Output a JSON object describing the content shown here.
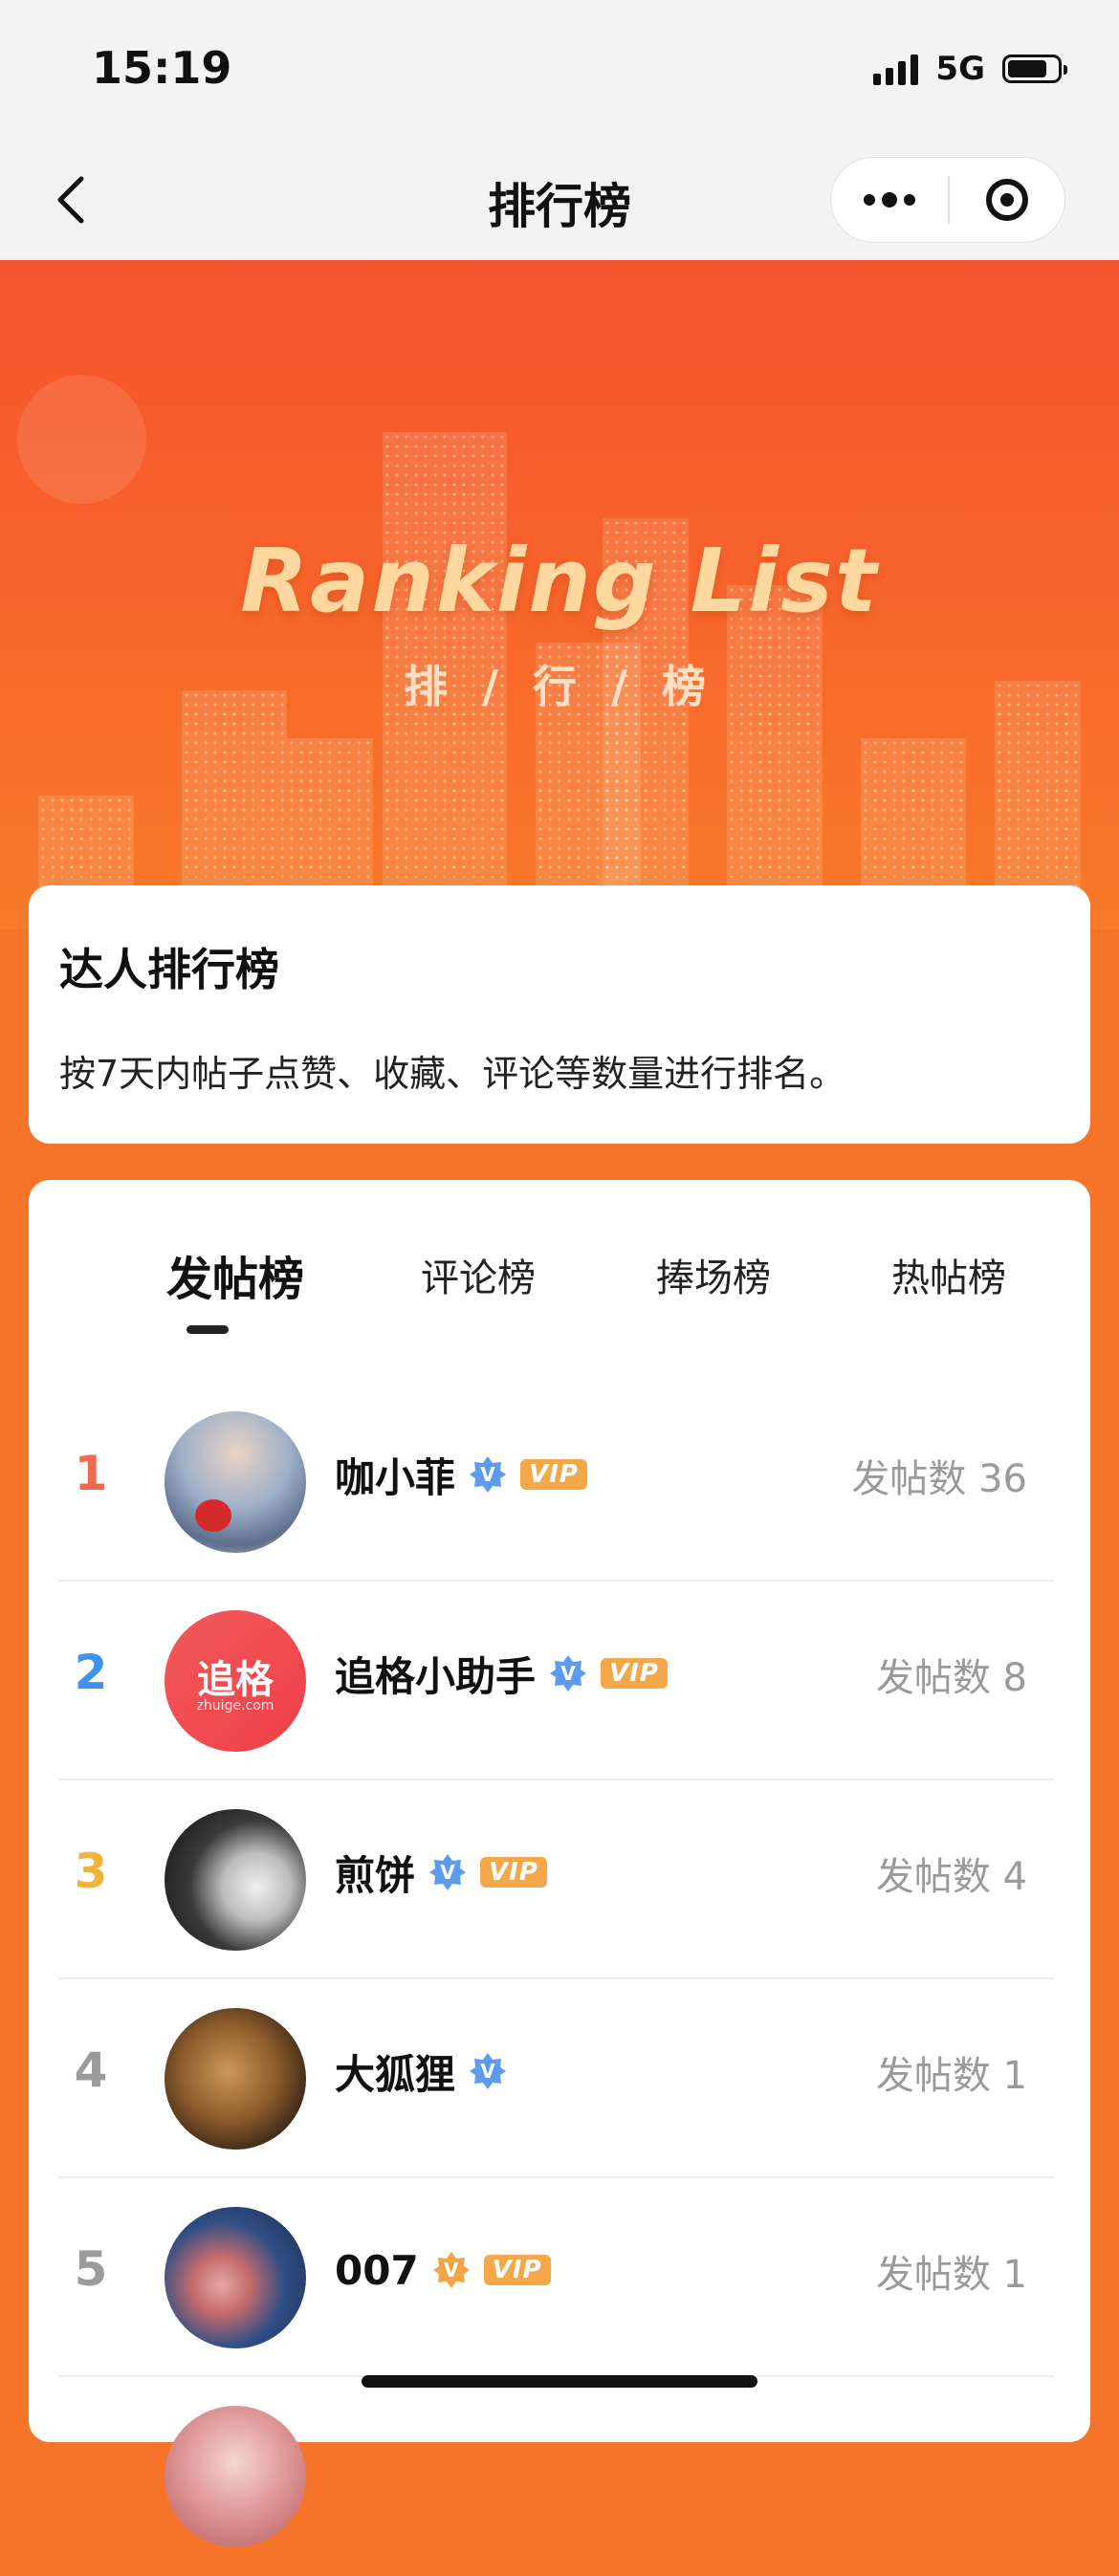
{
  "status_bar": {
    "time": "15:19",
    "network": "5G"
  },
  "nav": {
    "title": "排行榜"
  },
  "hero": {
    "title": "Ranking List",
    "subtitle": "排 / 行 / 榜"
  },
  "info_card": {
    "title": "达人排行榜",
    "description": "按7天内帖子点赞、收藏、评论等数量进行排名。"
  },
  "tabs": [
    {
      "label": "发帖榜",
      "active": true
    },
    {
      "label": "评论榜",
      "active": false
    },
    {
      "label": "捧场榜",
      "active": false
    },
    {
      "label": "热帖榜",
      "active": false
    }
  ],
  "rankings": [
    {
      "rank": "1",
      "rank_color": "#f06a4f",
      "name": "咖小菲",
      "verified_color": "#5b9cf2",
      "vip": "VIP",
      "count": "发帖数 36"
    },
    {
      "rank": "2",
      "rank_color": "#3f93ef",
      "name": "追格小助手",
      "verified_color": "#5b9cf2",
      "vip": "VIP",
      "count": "发帖数 8",
      "avatar_text": "追格",
      "avatar_url": "zhuige.com"
    },
    {
      "rank": "3",
      "rank_color": "#f2b33d",
      "name": "煎饼",
      "verified_color": "#5b9cf2",
      "vip": "VIP",
      "count": "发帖数 4"
    },
    {
      "rank": "4",
      "rank_color": "#9a9a9a",
      "name": "大狐狸",
      "verified_color": "#5b9cf2",
      "count": "发帖数 1"
    },
    {
      "rank": "5",
      "rank_color": "#9a9a9a",
      "name": "007",
      "verified_color": "#f2a545",
      "vip": "VIP",
      "count": "发帖数 1"
    }
  ],
  "colors": {
    "accent": "#f6742a",
    "vip": "#f5a84a",
    "verified_blue": "#5b9cf2",
    "verified_orange": "#f2a545"
  },
  "icons": [
    "back-arrow-icon",
    "more-dots-icon",
    "target-circle-icon",
    "verified-icon",
    "vip-icon",
    "signal-icon",
    "battery-icon"
  ]
}
